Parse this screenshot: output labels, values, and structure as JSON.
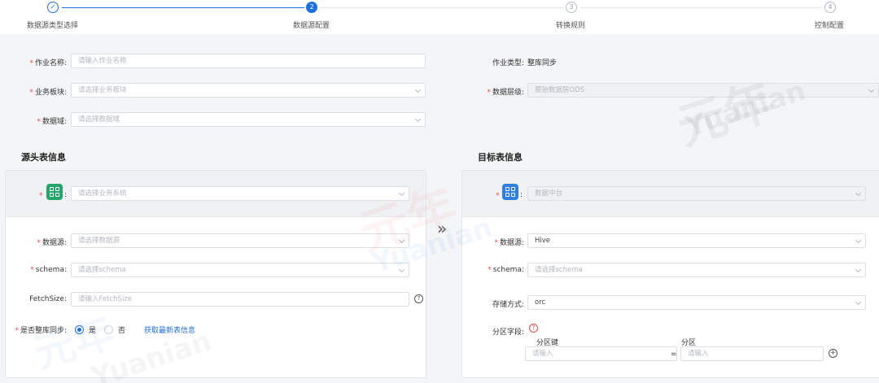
{
  "steps": [
    {
      "label": "数据源类型选择",
      "marker": "✓",
      "state": "done"
    },
    {
      "label": "数据源配置",
      "marker": "2",
      "state": "active"
    },
    {
      "label": "转换规则",
      "marker": "3",
      "state": "todo"
    },
    {
      "label": "控制配置",
      "marker": "4",
      "state": "todo"
    }
  ],
  "job": {
    "name_label": "作业名称:",
    "name_placeholder": "请输入作业名称",
    "business_label": "业务板块:",
    "business_placeholder": "请选择业务板块",
    "domain_label": "数据域:",
    "domain_placeholder": "请选择数据域",
    "type_label": "作业类型:",
    "type_value": "整库同步",
    "layer_label": "数据层级:",
    "layer_value": "原始数据层ODS"
  },
  "source": {
    "title": "源头表信息",
    "system_placeholder": "请选择业务系统",
    "datasource_label": "数据源:",
    "datasource_placeholder": "请选择数据源",
    "schema_label": "schema:",
    "schema_placeholder": "请选择schema",
    "fetchsize_label": "FetchSize:",
    "fetchsize_placeholder": "请输入FetchSize",
    "sync_label": "是否整库同步:",
    "yes": "是",
    "no": "否",
    "refresh_link": "获取最新表信息"
  },
  "target": {
    "title": "目标表信息",
    "platform_value": "数据中台",
    "datasource_label": "数据源:",
    "datasource_value": "Hive",
    "schema_label": "schema:",
    "schema_placeholder": "请选择schema",
    "storage_label": "存储方式:",
    "storage_value": "orc",
    "partition_label": "分区字段:",
    "partition_key_label": "分区键",
    "partition_label2": "分区",
    "partition_key_placeholder": "请输入",
    "partition_value_placeholder": "请输入",
    "equals": "="
  },
  "colon": ":",
  "arrow": "»",
  "help_glyph": "?",
  "add_glyph": "+",
  "watermark": {
    "cn": "元年",
    "en": "Yuanian"
  },
  "colors": {
    "primary": "#1f6fde",
    "required": "#e5484d",
    "source_icon": "#27a46b",
    "target_icon": "#2f7fe0"
  }
}
